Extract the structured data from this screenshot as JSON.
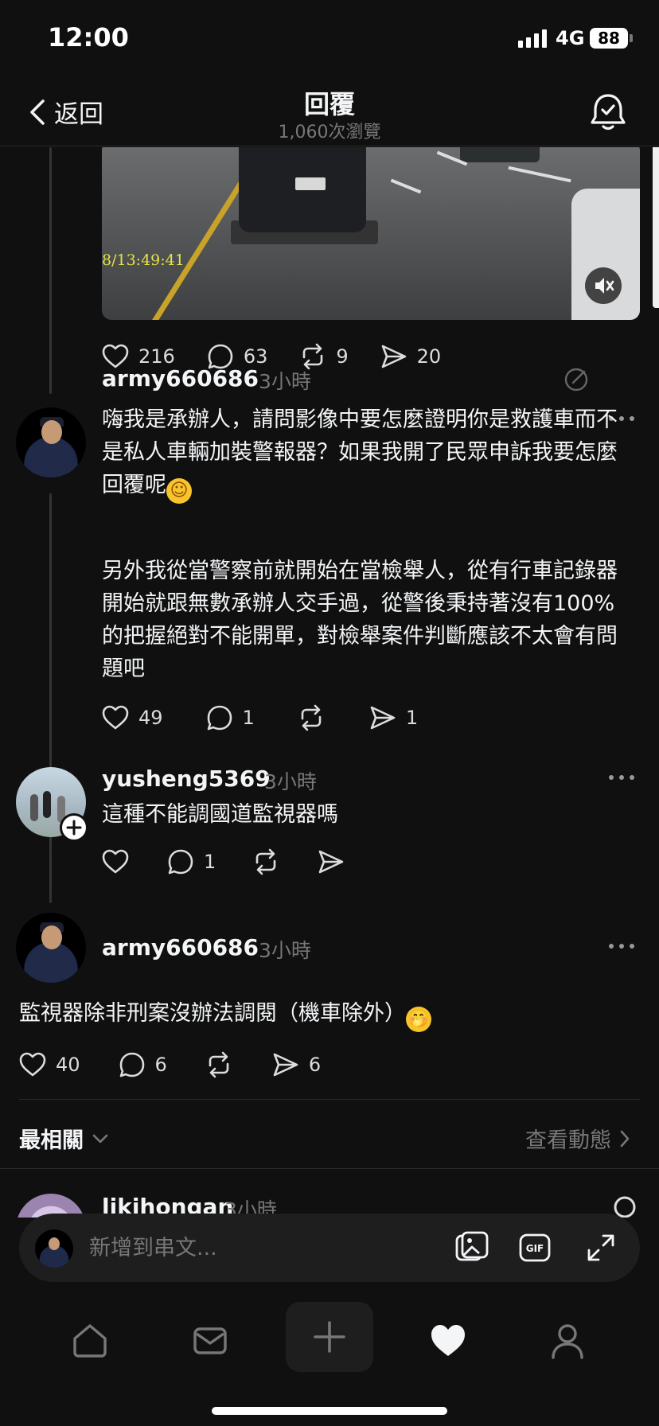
{
  "status_bar": {
    "time": "12:00",
    "network": "4G",
    "battery": "88"
  },
  "nav": {
    "back_label": "返回",
    "title": "回覆",
    "views": "1,060次瀏覽"
  },
  "video": {
    "timestamp": "8/13:49:41"
  },
  "post_actions": {
    "likes": "216",
    "comments": "63",
    "reposts": "9",
    "shares": "20"
  },
  "reply1": {
    "username": "army660686",
    "time": "3小時",
    "para1": "嗨我是承辦人，請問影像中要怎麼證明你是救護車而不是私人車輛加裝警報器？如果我開了民眾申訴我要怎麼回覆呢",
    "para1_emoji": "☺",
    "para2": "另外我從當警察前就開始在當檢舉人，從有行車記錄器開始就跟無數承辦人交手過，從警後秉持著沒有100%的把握絕對不能開單，對檢舉案件判斷應該不太會有問題吧",
    "likes": "49",
    "comments": "1",
    "shares": "1"
  },
  "reply2": {
    "username": "yusheng5369",
    "time": "3小時",
    "text": "這種不能調國道監視器嗎",
    "comments": "1"
  },
  "reply3": {
    "username": "army660686",
    "time": "3小時",
    "text": "監視器除非刑案沒辦法調閱（機車除外）",
    "text_emoji": "🤭",
    "likes": "40",
    "comments": "6",
    "shares": "6"
  },
  "sort": {
    "label": "最相關",
    "activity": "查看動態"
  },
  "next_reply": {
    "username": "likihongan",
    "time": "3小時"
  },
  "composer": {
    "placeholder": "新增到串文..."
  },
  "colors": {
    "background": "#101010",
    "text": "#f3f5f7",
    "muted": "#777777",
    "divider": "#2a2a2a"
  }
}
